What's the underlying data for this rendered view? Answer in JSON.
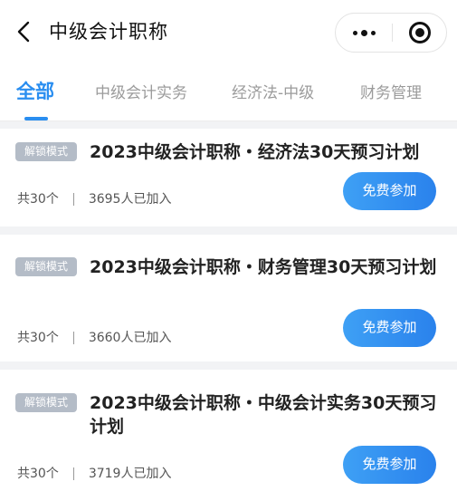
{
  "header": {
    "title": "中级会计职称",
    "back_icon": "chevron-left-icon",
    "more_icon": "more-dots-icon",
    "close_icon": "target-close-icon"
  },
  "tabs": [
    {
      "label": "全部",
      "active": true
    },
    {
      "label": "中级会计实务",
      "active": false
    },
    {
      "label": "经济法-中级",
      "active": false
    },
    {
      "label": "财务管理",
      "active": false
    }
  ],
  "cards": [
    {
      "badge": "解锁模式",
      "title": "2023中级会计职称・经济法30天预习计划",
      "count": "共30个",
      "joined": "3695人已加入",
      "button": "免费参加"
    },
    {
      "badge": "解锁模式",
      "title": "2023中级会计职称・财务管理30天预习计划",
      "count": "共30个",
      "joined": "3660人已加入",
      "button": "免费参加"
    },
    {
      "badge": "解锁模式",
      "title": "2023中级会计职称・中级会计实务30天预习计划",
      "count": "共30个",
      "joined": "3719人已加入",
      "button": "免费参加"
    }
  ],
  "colors": {
    "accent": "#2a8ef0",
    "badge": "#b4bcc7",
    "background": "#f2f3f5"
  }
}
